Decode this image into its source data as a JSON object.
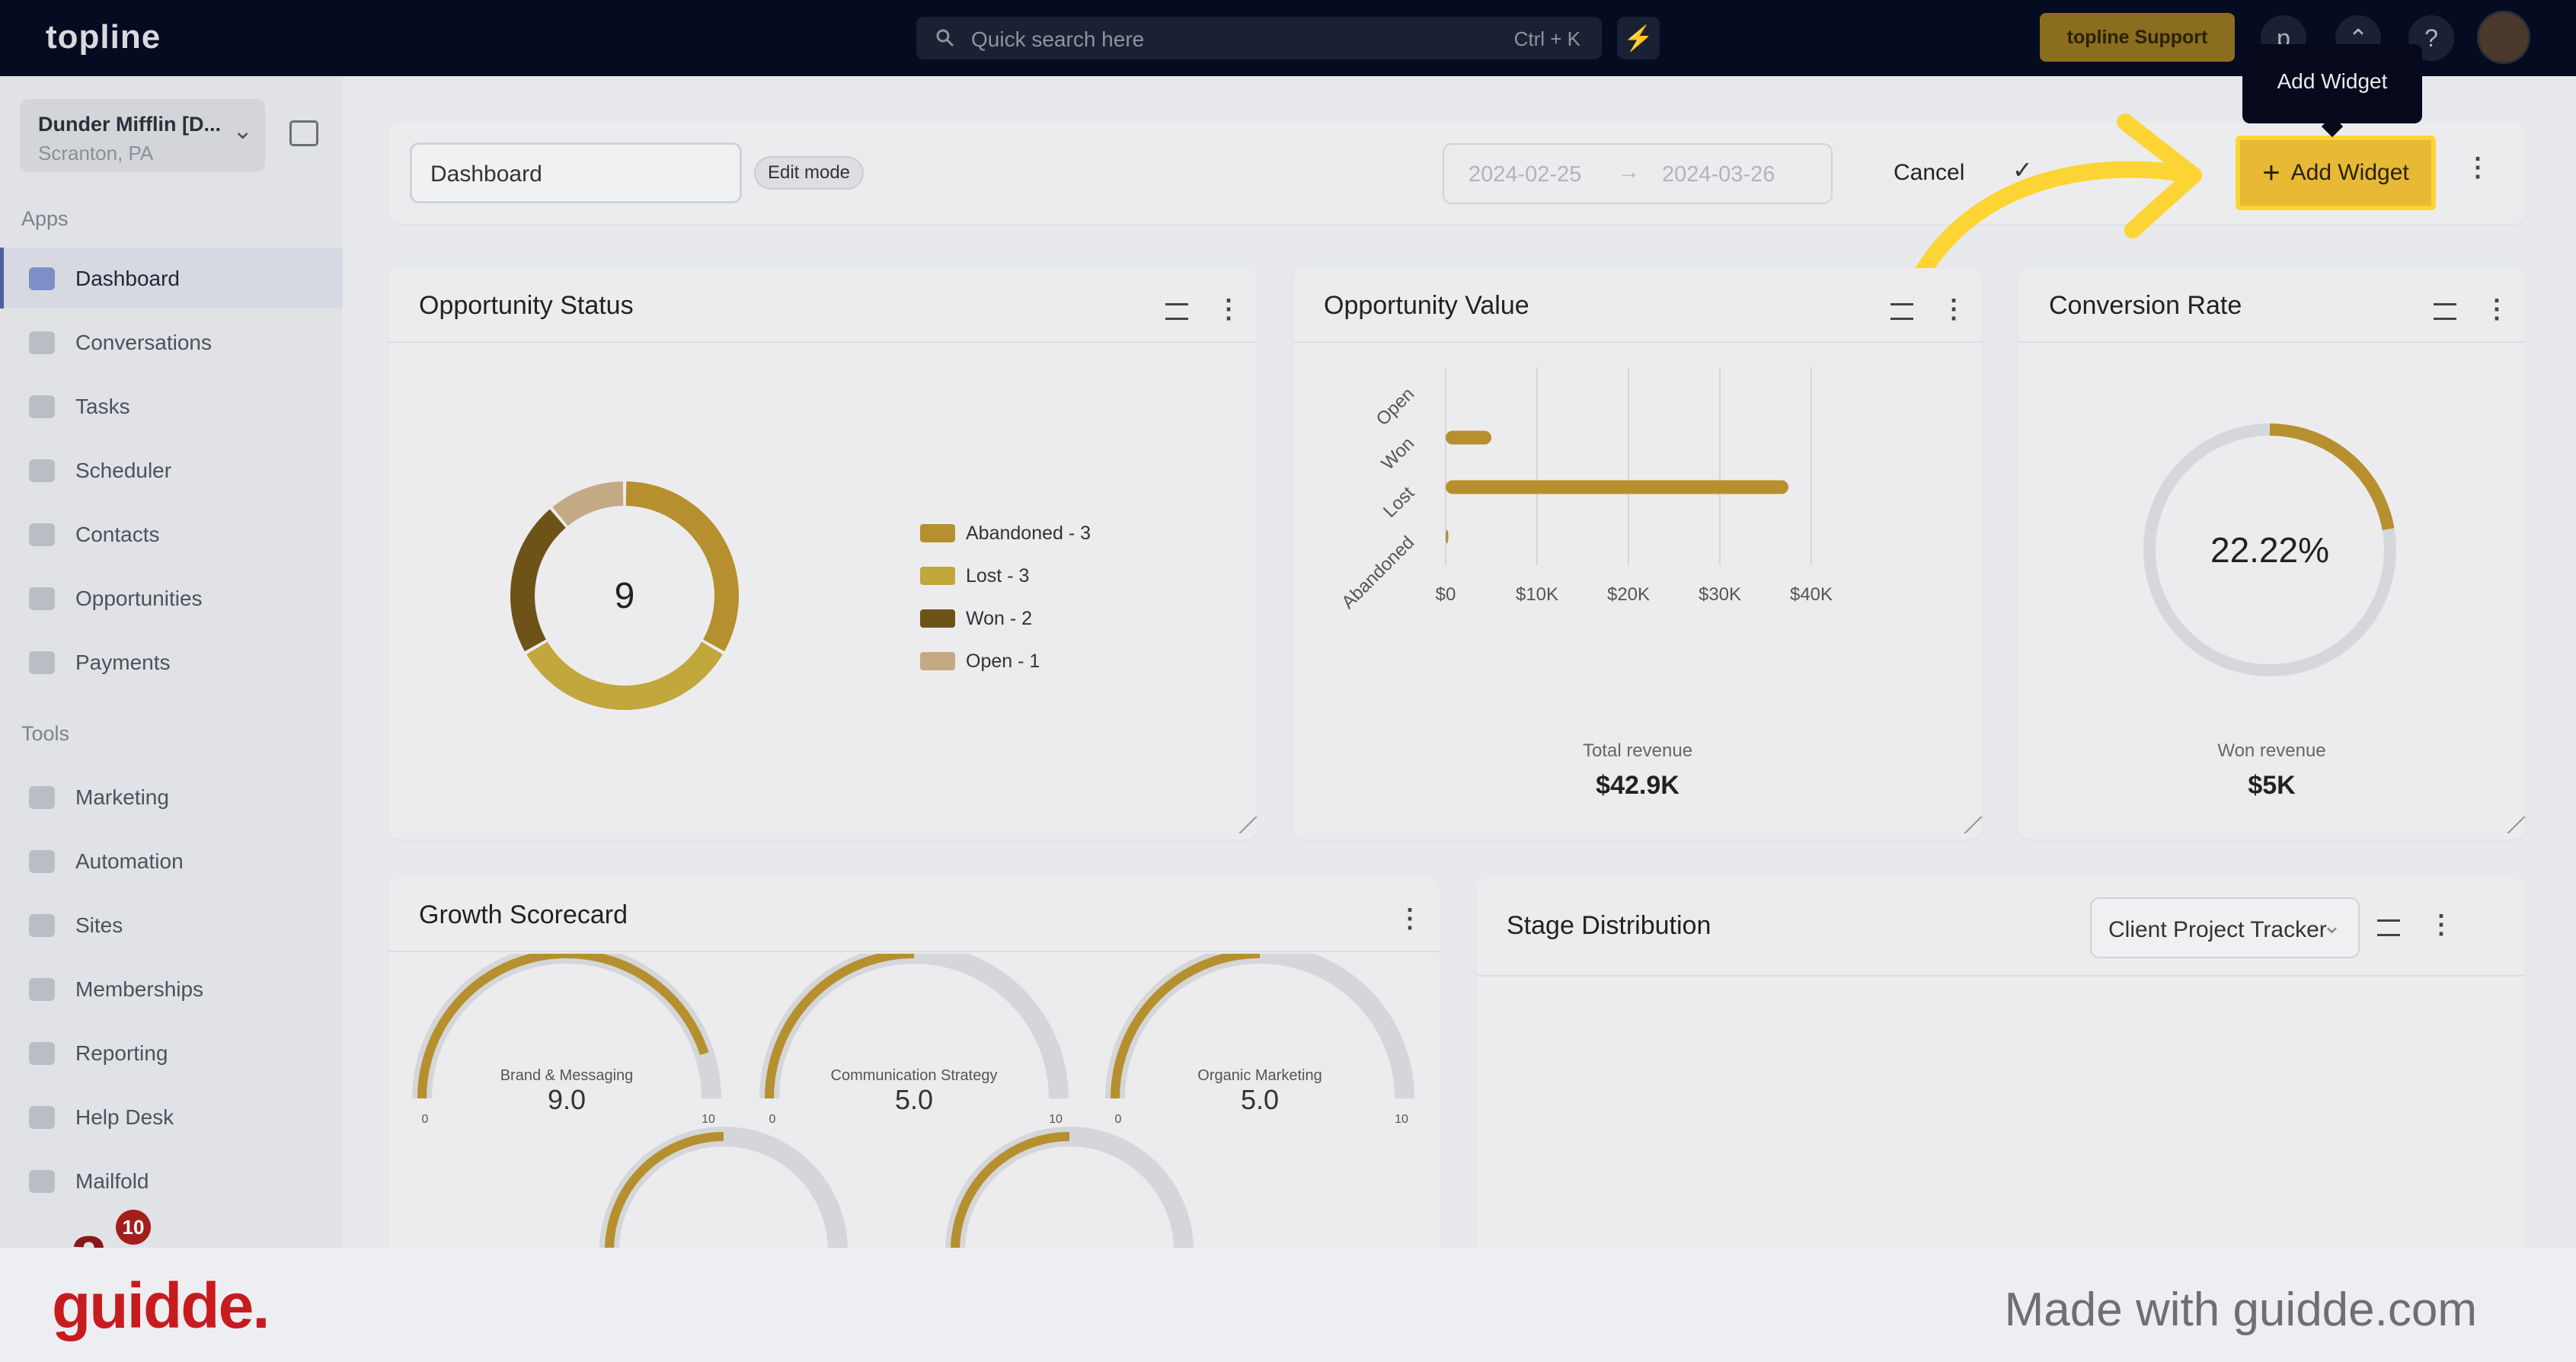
{
  "topbar": {
    "logo": "topline",
    "search_placeholder": "Quick search here",
    "search_shortcut": "Ctrl + K",
    "support_label": "topline Support",
    "icon_p": "p",
    "icon_help": "?"
  },
  "sidebar": {
    "location_name": "Dunder Mifflin [D...",
    "location_address": "Scranton, PA",
    "apps_label": "Apps",
    "tools_label": "Tools",
    "apps": [
      {
        "label": "Dashboard",
        "icon": "dashboard-icon"
      },
      {
        "label": "Conversations",
        "icon": "chat-icon"
      },
      {
        "label": "Tasks",
        "icon": "tasks-icon"
      },
      {
        "label": "Scheduler",
        "icon": "calendar-icon"
      },
      {
        "label": "Contacts",
        "icon": "user-icon"
      },
      {
        "label": "Opportunities",
        "icon": "target-icon"
      },
      {
        "label": "Payments",
        "icon": "card-icon"
      }
    ],
    "tools": [
      {
        "label": "Marketing",
        "icon": "megaphone-icon"
      },
      {
        "label": "Automation",
        "icon": "gears-icon"
      },
      {
        "label": "Sites",
        "icon": "globe-icon"
      },
      {
        "label": "Memberships",
        "icon": "people-icon"
      },
      {
        "label": "Reporting",
        "icon": "pie-icon"
      },
      {
        "label": "Help Desk",
        "icon": "help-icon"
      },
      {
        "label": "Mailfold",
        "icon": "chart-icon"
      }
    ],
    "badge_count": "10"
  },
  "toolbar": {
    "dashboard_name": "Dashboard",
    "edit_mode": "Edit mode",
    "date_start": "2024-02-25",
    "date_arrow": "→",
    "date_end": "2024-03-26",
    "cancel": "Cancel",
    "add_widget": "Add Widget",
    "tooltip": "Add Widget"
  },
  "opportunity_status": {
    "title": "Opportunity Status",
    "total": "9"
  },
  "opportunity_value": {
    "title": "Opportunity Value",
    "total_label": "Total revenue",
    "total_value": "$42.9K"
  },
  "conversion": {
    "title": "Conversion Rate",
    "rate": "22.22%",
    "fraction": 0.2222,
    "won_label": "Won revenue",
    "won_value": "$5K"
  },
  "growth": {
    "title": "Growth Scorecard",
    "gauges": [
      {
        "label": "Brand & Messaging",
        "value": "9.0",
        "fraction": 0.9,
        "min": "0",
        "max": "10"
      },
      {
        "label": "Communication Strategy",
        "value": "5.0",
        "fraction": 0.5,
        "min": "0",
        "max": "10"
      },
      {
        "label": "Organic Marketing",
        "value": "5.0",
        "fraction": 0.5,
        "min": "0",
        "max": "10"
      }
    ]
  },
  "stage": {
    "title": "Stage Distribution",
    "pipeline": "Client Project Tracker"
  },
  "footer": {
    "brand": "guidde.",
    "made_with": "Made with guidde.com"
  },
  "chart_data": [
    {
      "type": "pie",
      "title": "Opportunity Status",
      "center_label": "9",
      "categories": [
        "Abandoned",
        "Lost",
        "Won",
        "Open"
      ],
      "values": [
        3,
        3,
        2,
        1
      ],
      "legend_labels": [
        "Abandoned - 3",
        "Lost - 3",
        "Won - 2",
        "Open - 1"
      ],
      "colors": [
        "#b6902e",
        "#c1a73c",
        "#6e5318",
        "#c4a985"
      ],
      "legend": "right"
    },
    {
      "type": "bar",
      "orientation": "horizontal",
      "title": "Opportunity Value",
      "categories": [
        "Open",
        "Won",
        "Lost",
        "Abandoned"
      ],
      "values": [
        0,
        5000,
        37500,
        300
      ],
      "xticks": [
        "$0",
        "$10K",
        "$20K",
        "$30K",
        "$40K"
      ],
      "xlim": [
        0,
        40000
      ],
      "grid": true
    }
  ]
}
